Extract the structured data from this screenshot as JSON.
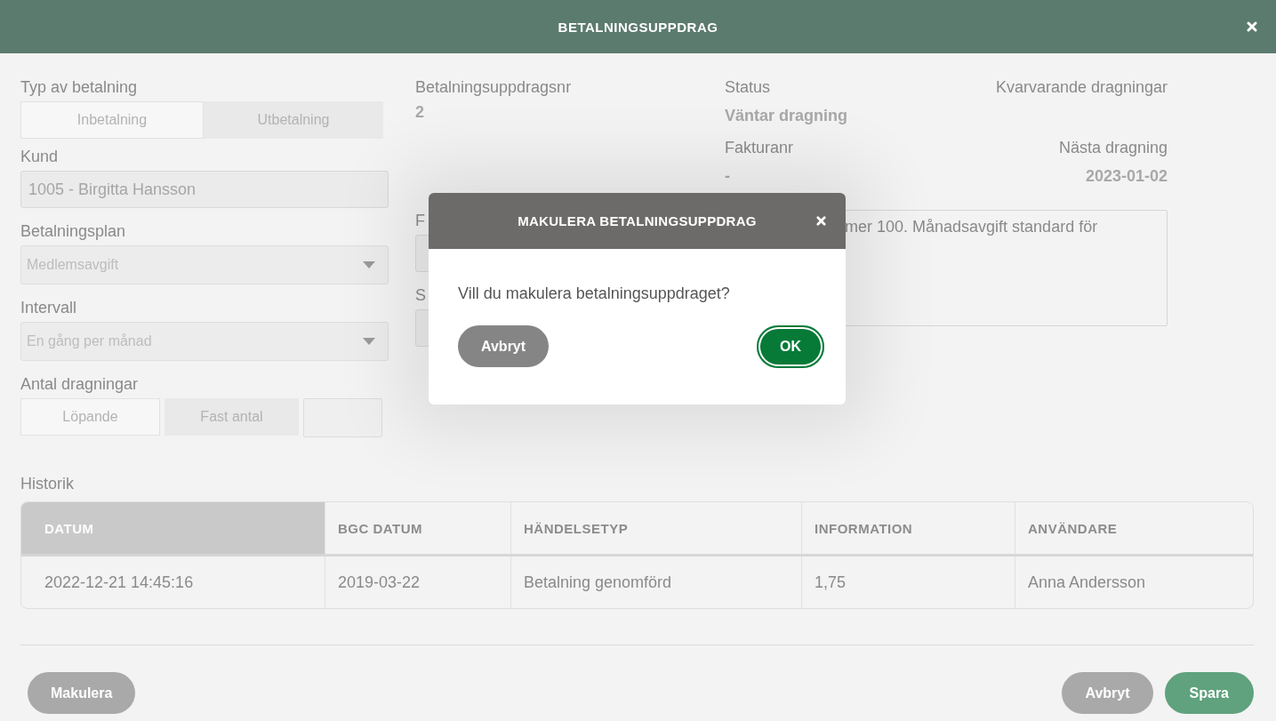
{
  "window": {
    "title": "BETALNINGSUPPDRAG"
  },
  "form": {
    "payment_type": {
      "label": "Typ av betalning",
      "options": [
        {
          "label": "Inbetalning",
          "selected": true
        },
        {
          "label": "Utbetalning",
          "selected": false
        }
      ]
    },
    "customer": {
      "label": "Kund",
      "value": "1005 - Birgitta Hansson"
    },
    "plan": {
      "label": "Betalningsplan",
      "value": "Medlemsavgift"
    },
    "interval": {
      "label": "Intervall",
      "value": "En gång per månad"
    },
    "draw_count": {
      "label": "Antal dragningar",
      "options": [
        {
          "label": "Löpande",
          "selected": true
        },
        {
          "label": "Fast antal",
          "selected": false
        }
      ]
    },
    "order_number": {
      "label": "Betalningsuppdragsnr",
      "value": "2"
    },
    "field_1": {
      "label": "F"
    },
    "field_2": {
      "label": "S"
    },
    "status": {
      "label": "Status",
      "value": "Väntar dragning"
    },
    "remaining": {
      "label": "Kvarvarande dragningar"
    },
    "invoice": {
      "label": "Fakturanr",
      "value": "-"
    },
    "next_draw": {
      "label": "Nästa dragning",
      "value": "2023-01-02"
    },
    "note": {
      "value": "mer 100. Månadsavgift standard för"
    }
  },
  "history": {
    "title": "Historik",
    "columns": [
      {
        "label": "DATUM",
        "sorted": true
      },
      {
        "label": "BGC DATUM",
        "sorted": false
      },
      {
        "label": "HÄNDELSETYP",
        "sorted": false
      },
      {
        "label": "INFORMATION",
        "sorted": false
      },
      {
        "label": "ANVÄNDARE",
        "sorted": false
      }
    ],
    "rows": [
      [
        "2022-12-21 14:45:16",
        "2019-03-22",
        "Betalning genomförd",
        "1,75",
        "Anna Andersson"
      ]
    ]
  },
  "footer": {
    "buttons": [
      {
        "label": "Makulera",
        "kind": "neutral"
      },
      {
        "label": "Avbryt",
        "kind": "neutral"
      },
      {
        "label": "Spara",
        "kind": "primary"
      }
    ]
  },
  "dialog": {
    "title": "MAKULERA BETALNINGSUPPDRAG",
    "message": "Vill du makulera betalningsuppdraget?",
    "buttons": [
      {
        "label": "Avbryt",
        "kind": "neutral"
      },
      {
        "label": "OK",
        "kind": "confirm"
      }
    ]
  }
}
